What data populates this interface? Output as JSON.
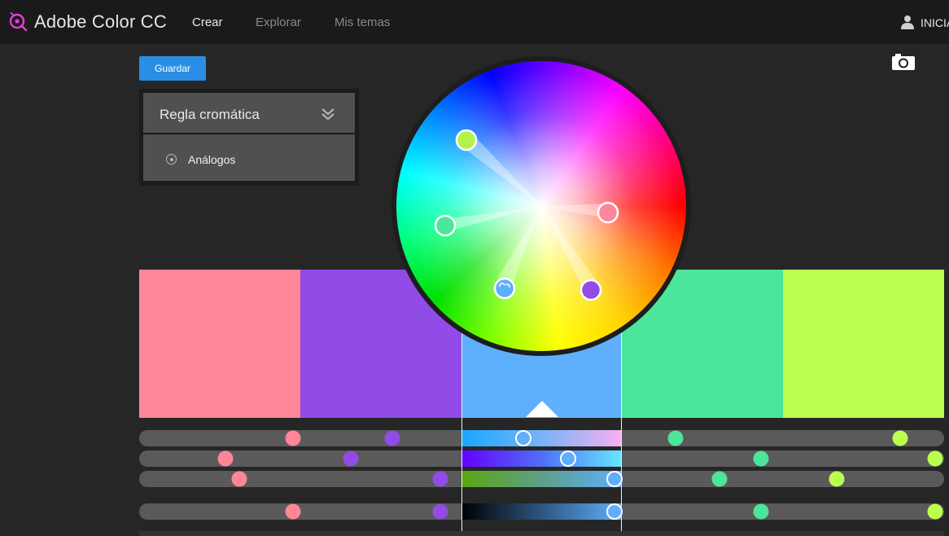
{
  "app": {
    "title": "Adobe Color CC",
    "brand_color": "#e040d8"
  },
  "nav": {
    "items": [
      {
        "label": "Crear",
        "active": true
      },
      {
        "label": "Explorar",
        "active": false
      },
      {
        "label": "Mis temas",
        "active": false
      }
    ],
    "user_label": "INICIA",
    "user_icon": "user-icon"
  },
  "toolbar": {
    "save_label": "Guardar",
    "camera_icon": "camera-icon"
  },
  "rule_panel": {
    "title": "Regla cromática",
    "option": "Análogos",
    "chevron_icon": "double-chevron-down-icon"
  },
  "swatches": [
    {
      "color": "#ff8599"
    },
    {
      "color": "#914be6"
    },
    {
      "color": "#5eaffc",
      "selected": true
    },
    {
      "color": "#4be59c"
    },
    {
      "color": "#bbff4f"
    }
  ],
  "sliders": [
    {
      "dots": [
        0.191,
        0.314,
        0.666,
        0.945
      ],
      "active_handle": 0.39,
      "gradient": [
        "#19a7ff",
        "#76b4f6",
        "#f6b0f2"
      ]
    },
    {
      "dots": [
        0.107,
        0.263,
        0.773,
        0.989
      ],
      "active_handle": 0.67,
      "gradient": [
        "#6400ff",
        "#4f6ff7",
        "#65e6ff"
      ]
    },
    {
      "dots": [
        0.124,
        0.374,
        0.721,
        0.867
      ],
      "active_handle": 0.96,
      "gradient": [
        "#5aa70f",
        "#5e9f88",
        "#5eaffc"
      ]
    },
    {
      "dots": [
        0.191,
        0.374,
        0.773,
        0.989
      ],
      "active_handle": 0.96,
      "gradient": [
        "#000000",
        "#2e557f",
        "#5eaffc"
      ]
    }
  ]
}
